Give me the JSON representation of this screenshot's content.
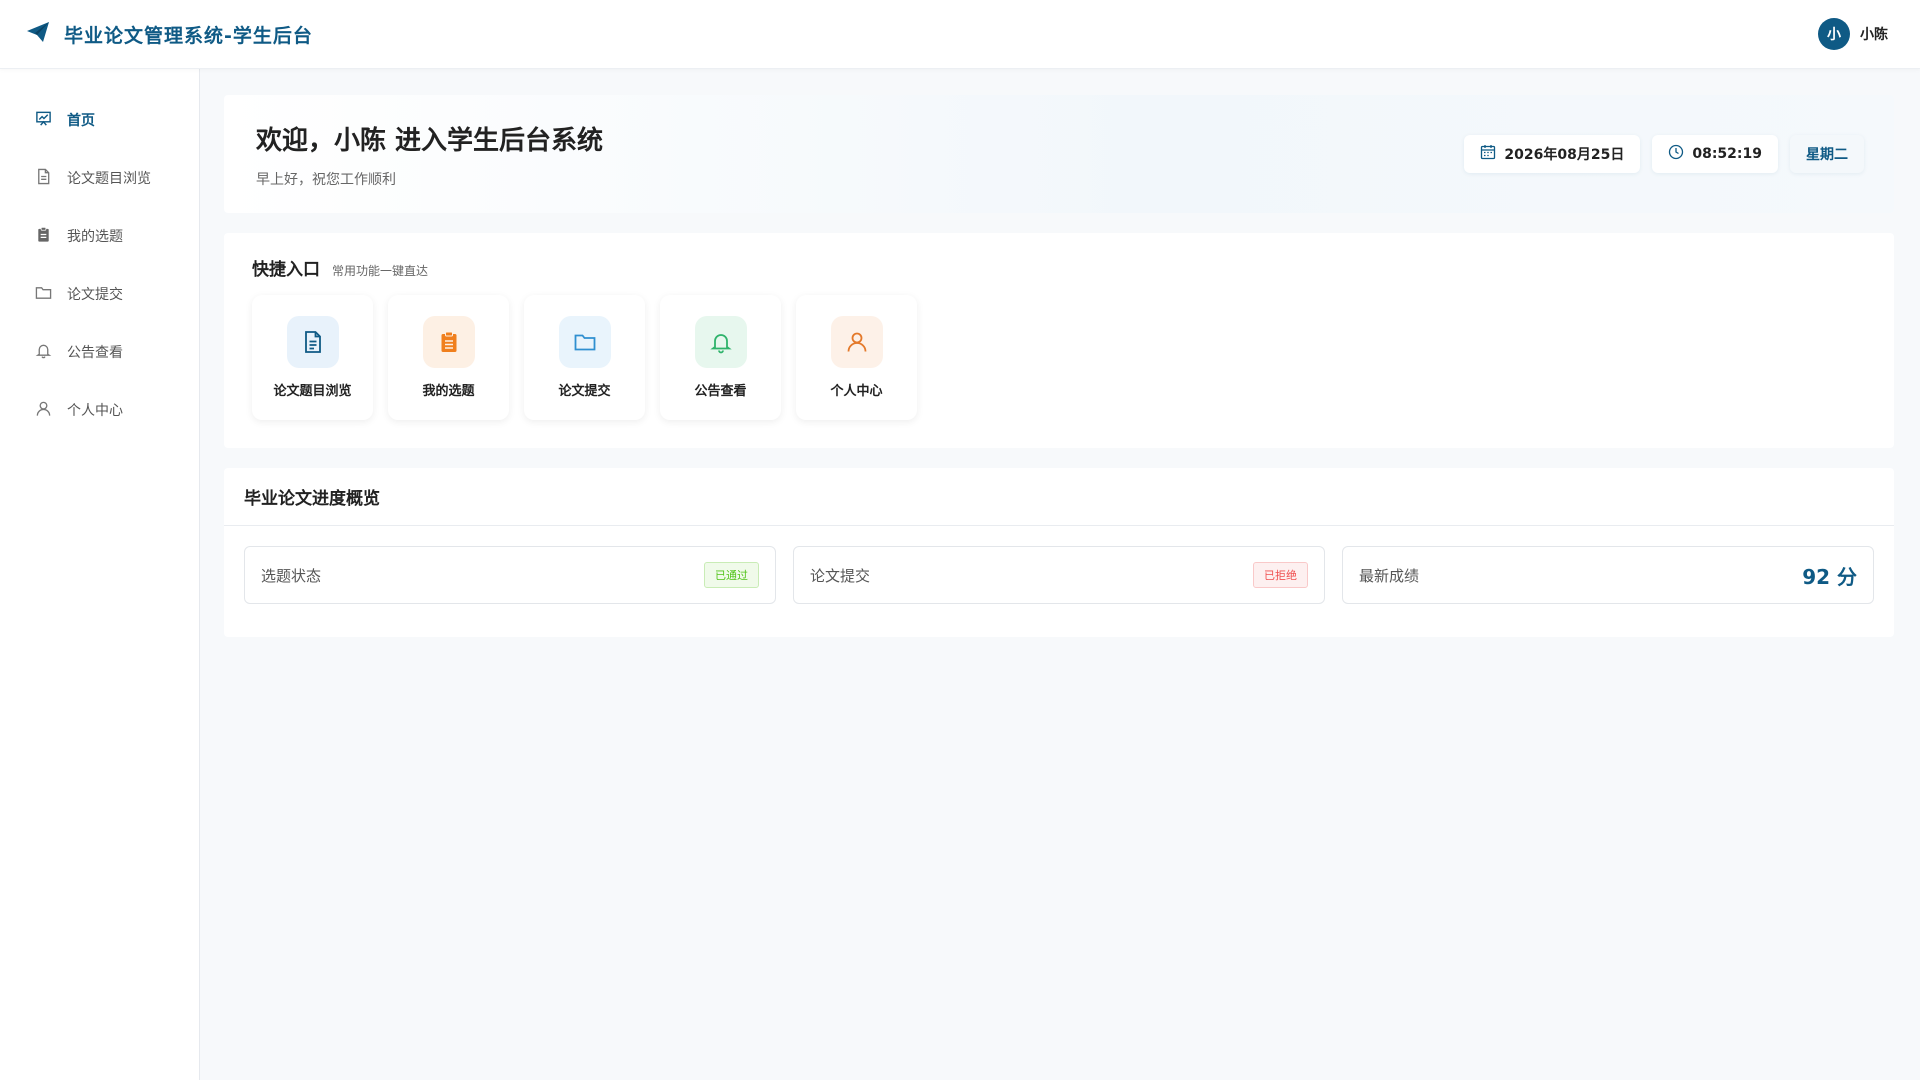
{
  "header": {
    "brand_title": "毕业论文管理系统-学生后台",
    "brand_icon": "paper-plane-icon",
    "user_initial": "小",
    "user_name": "小陈"
  },
  "sidebar": {
    "items": [
      {
        "label": "首页",
        "icon": "home-chart-icon",
        "active": true
      },
      {
        "label": "论文题目浏览",
        "icon": "document-icon"
      },
      {
        "label": "我的选题",
        "icon": "clipboard-icon"
      },
      {
        "label": "论文提交",
        "icon": "folder-icon"
      },
      {
        "label": "公告查看",
        "icon": "bell-icon"
      },
      {
        "label": "个人中心",
        "icon": "user-icon"
      }
    ]
  },
  "welcome": {
    "title": "欢迎，小陈 进入学生后台系统",
    "subtitle": "早上好，祝您工作顺利",
    "date": "2026年08月25日",
    "time": "08:52:19",
    "weekday": "星期二"
  },
  "quick": {
    "title": "快捷入口",
    "subtitle": "常用功能一键直达",
    "items": [
      {
        "label": "论文题目浏览",
        "icon": "document-icon",
        "color": "#0f5a85",
        "bg": "#e8f2fb"
      },
      {
        "label": "我的选题",
        "icon": "clipboard-icon",
        "color": "#f07f1d",
        "bg": "#fdf0e4"
      },
      {
        "label": "论文提交",
        "icon": "folder-icon",
        "color": "#2f8fd0",
        "bg": "#e9f4fc"
      },
      {
        "label": "公告查看",
        "icon": "bell-icon",
        "color": "#2fb36b",
        "bg": "#e7f7ee"
      },
      {
        "label": "个人中心",
        "icon": "user-icon",
        "color": "#e4792a",
        "bg": "#fdf1e8"
      }
    ]
  },
  "progress": {
    "title": "毕业论文进度概览",
    "cards": [
      {
        "label": "选题状态",
        "tag": "已通过",
        "tag_type": "ok"
      },
      {
        "label": "论文提交",
        "tag": "已拒绝",
        "tag_type": "bad"
      },
      {
        "label": "最新成绩",
        "score": "92 分"
      }
    ]
  }
}
